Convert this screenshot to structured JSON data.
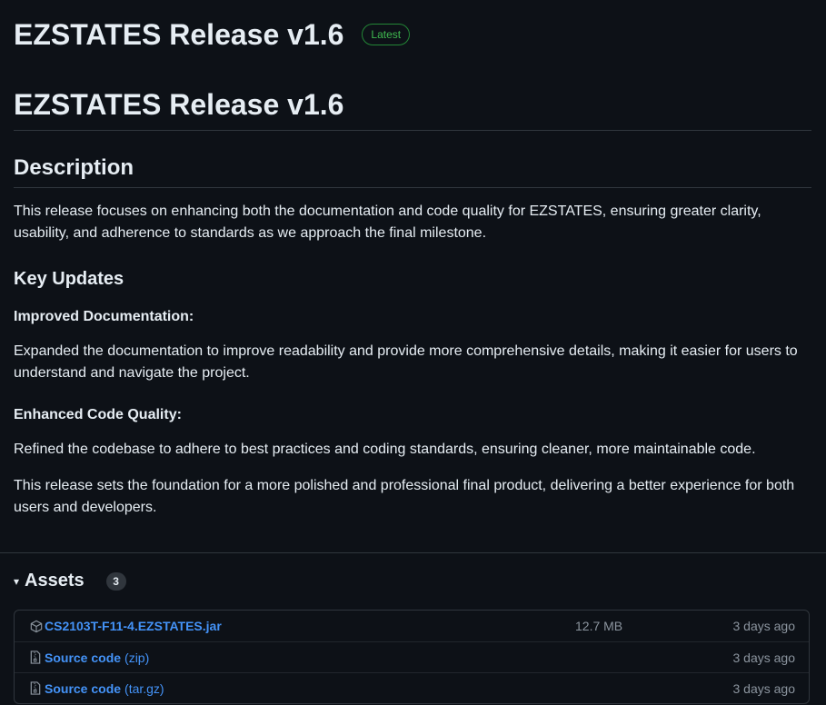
{
  "release": {
    "title": "EZSTATES Release v1.6",
    "badge": "Latest"
  },
  "notes": {
    "h1": "EZSTATES Release v1.6",
    "description_heading": "Description",
    "description_text": "This release focuses on enhancing both the documentation and code quality for EZSTATES, ensuring greater clarity, usability, and adherence to standards as we approach the final milestone.",
    "key_updates_heading": "Key Updates",
    "doc_heading": "Improved Documentation:",
    "doc_text": "Expanded the documentation to improve readability and provide more comprehensive details, making it easier for users to understand and navigate the project.",
    "code_heading": "Enhanced Code Quality:",
    "code_text": "Refined the codebase to adhere to best practices and coding standards, ensuring cleaner, more maintainable code.",
    "closing_text": "This release sets the foundation for a more polished and professional final product, delivering a better experience for both users and developers."
  },
  "assets": {
    "caret": "▾",
    "title": "Assets",
    "count": "3",
    "items": [
      {
        "name": "CS2103T-F11-4.EZSTATES.jar",
        "ext": "",
        "size": "12.7 MB",
        "date": "3 days ago",
        "icon": "package-icon"
      },
      {
        "name": "Source code",
        "ext": "(zip)",
        "size": "",
        "date": "3 days ago",
        "icon": "file-zip-icon"
      },
      {
        "name": "Source code",
        "ext": "(tar.gz)",
        "size": "",
        "date": "3 days ago",
        "icon": "file-zip-icon"
      }
    ]
  },
  "colors": {
    "background": "#0d1117",
    "text": "#e6edf3",
    "link": "#4493f8",
    "muted": "#8b949e",
    "border": "#30363d",
    "badge_green": "#3fb950"
  }
}
